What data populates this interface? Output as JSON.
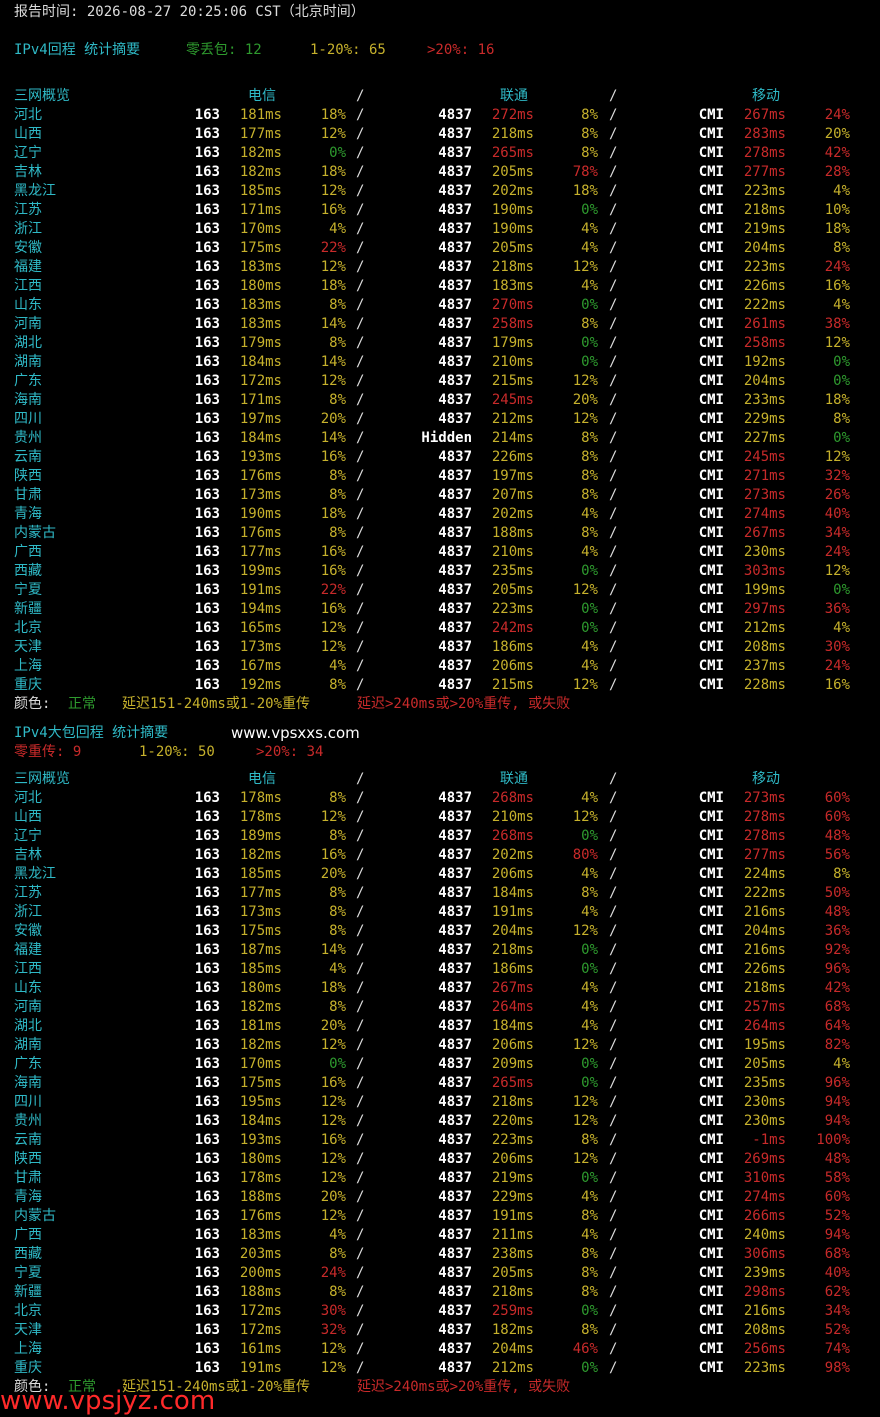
{
  "report_time": "报告时间: 2026-08-27 20:25:06 CST（北京时间）",
  "colors": {
    "normal": "#2e9a2e",
    "warn": "#c6b12c",
    "bad": "#c82a2a",
    "header": "#2fb9c6"
  },
  "sections": [
    {
      "title": "IPv4回程 统计摘要",
      "summary": [
        {
          "text": "零丢包: 12",
          "color": "green"
        },
        {
          "text": "1-20%: 65",
          "color": "yellow"
        },
        {
          "text": ">20%: 16",
          "color": "red"
        }
      ],
      "headers": {
        "region": "三网概览",
        "telecom": "电信",
        "unicom": "联通",
        "mobile": "移动",
        "sep": "/"
      },
      "rows": [
        [
          "河北",
          "163",
          "181ms",
          "y",
          "18%",
          "y",
          "4837",
          "272ms",
          "r",
          "8%",
          "y",
          "CMI",
          "267ms",
          "r",
          "24%",
          "r"
        ],
        [
          "山西",
          "163",
          "177ms",
          "y",
          "12%",
          "y",
          "4837",
          "218ms",
          "y",
          "8%",
          "y",
          "CMI",
          "283ms",
          "r",
          "20%",
          "y"
        ],
        [
          "辽宁",
          "163",
          "182ms",
          "y",
          "0%",
          "g",
          "4837",
          "265ms",
          "r",
          "8%",
          "y",
          "CMI",
          "278ms",
          "r",
          "42%",
          "r"
        ],
        [
          "吉林",
          "163",
          "182ms",
          "y",
          "18%",
          "y",
          "4837",
          "205ms",
          "y",
          "78%",
          "r",
          "CMI",
          "277ms",
          "r",
          "28%",
          "r"
        ],
        [
          "黑龙江",
          "163",
          "185ms",
          "y",
          "12%",
          "y",
          "4837",
          "202ms",
          "y",
          "18%",
          "y",
          "CMI",
          "223ms",
          "y",
          "4%",
          "y"
        ],
        [
          "江苏",
          "163",
          "171ms",
          "y",
          "16%",
          "y",
          "4837",
          "190ms",
          "y",
          "0%",
          "g",
          "CMI",
          "218ms",
          "y",
          "10%",
          "y"
        ],
        [
          "浙江",
          "163",
          "170ms",
          "y",
          "4%",
          "y",
          "4837",
          "190ms",
          "y",
          "4%",
          "y",
          "CMI",
          "219ms",
          "y",
          "18%",
          "y"
        ],
        [
          "安徽",
          "163",
          "175ms",
          "y",
          "22%",
          "r",
          "4837",
          "205ms",
          "y",
          "4%",
          "y",
          "CMI",
          "204ms",
          "y",
          "8%",
          "y"
        ],
        [
          "福建",
          "163",
          "183ms",
          "y",
          "12%",
          "y",
          "4837",
          "218ms",
          "y",
          "12%",
          "y",
          "CMI",
          "223ms",
          "y",
          "24%",
          "r"
        ],
        [
          "江西",
          "163",
          "180ms",
          "y",
          "18%",
          "y",
          "4837",
          "183ms",
          "y",
          "4%",
          "y",
          "CMI",
          "226ms",
          "y",
          "16%",
          "y"
        ],
        [
          "山东",
          "163",
          "183ms",
          "y",
          "8%",
          "y",
          "4837",
          "270ms",
          "r",
          "0%",
          "g",
          "CMI",
          "222ms",
          "y",
          "4%",
          "y"
        ],
        [
          "河南",
          "163",
          "183ms",
          "y",
          "14%",
          "y",
          "4837",
          "258ms",
          "r",
          "8%",
          "y",
          "CMI",
          "261ms",
          "r",
          "38%",
          "r"
        ],
        [
          "湖北",
          "163",
          "179ms",
          "y",
          "8%",
          "y",
          "4837",
          "179ms",
          "y",
          "0%",
          "g",
          "CMI",
          "258ms",
          "r",
          "12%",
          "y"
        ],
        [
          "湖南",
          "163",
          "184ms",
          "y",
          "14%",
          "y",
          "4837",
          "210ms",
          "y",
          "0%",
          "g",
          "CMI",
          "192ms",
          "y",
          "0%",
          "g"
        ],
        [
          "广东",
          "163",
          "172ms",
          "y",
          "12%",
          "y",
          "4837",
          "215ms",
          "y",
          "12%",
          "y",
          "CMI",
          "204ms",
          "y",
          "0%",
          "g"
        ],
        [
          "海南",
          "163",
          "171ms",
          "y",
          "8%",
          "y",
          "4837",
          "245ms",
          "r",
          "20%",
          "y",
          "CMI",
          "233ms",
          "y",
          "18%",
          "y"
        ],
        [
          "四川",
          "163",
          "197ms",
          "y",
          "20%",
          "y",
          "4837",
          "212ms",
          "y",
          "12%",
          "y",
          "CMI",
          "229ms",
          "y",
          "8%",
          "y"
        ],
        [
          "贵州",
          "163",
          "184ms",
          "y",
          "14%",
          "y",
          "Hidden",
          "214ms",
          "y",
          "8%",
          "y",
          "CMI",
          "227ms",
          "y",
          "0%",
          "g"
        ],
        [
          "云南",
          "163",
          "193ms",
          "y",
          "16%",
          "y",
          "4837",
          "226ms",
          "y",
          "8%",
          "y",
          "CMI",
          "245ms",
          "r",
          "12%",
          "y"
        ],
        [
          "陕西",
          "163",
          "176ms",
          "y",
          "8%",
          "y",
          "4837",
          "197ms",
          "y",
          "8%",
          "y",
          "CMI",
          "271ms",
          "r",
          "32%",
          "r"
        ],
        [
          "甘肃",
          "163",
          "173ms",
          "y",
          "8%",
          "y",
          "4837",
          "207ms",
          "y",
          "8%",
          "y",
          "CMI",
          "273ms",
          "r",
          "26%",
          "r"
        ],
        [
          "青海",
          "163",
          "190ms",
          "y",
          "18%",
          "y",
          "4837",
          "202ms",
          "y",
          "4%",
          "y",
          "CMI",
          "274ms",
          "r",
          "40%",
          "r"
        ],
        [
          "内蒙古",
          "163",
          "176ms",
          "y",
          "8%",
          "y",
          "4837",
          "188ms",
          "y",
          "8%",
          "y",
          "CMI",
          "267ms",
          "r",
          "34%",
          "r"
        ],
        [
          "广西",
          "163",
          "177ms",
          "y",
          "16%",
          "y",
          "4837",
          "210ms",
          "y",
          "4%",
          "y",
          "CMI",
          "230ms",
          "y",
          "24%",
          "r"
        ],
        [
          "西藏",
          "163",
          "199ms",
          "y",
          "16%",
          "y",
          "4837",
          "235ms",
          "y",
          "0%",
          "g",
          "CMI",
          "303ms",
          "r",
          "12%",
          "y"
        ],
        [
          "宁夏",
          "163",
          "191ms",
          "y",
          "22%",
          "r",
          "4837",
          "205ms",
          "y",
          "12%",
          "y",
          "CMI",
          "199ms",
          "y",
          "0%",
          "g"
        ],
        [
          "新疆",
          "163",
          "194ms",
          "y",
          "16%",
          "y",
          "4837",
          "223ms",
          "y",
          "0%",
          "g",
          "CMI",
          "297ms",
          "r",
          "36%",
          "r"
        ],
        [
          "北京",
          "163",
          "165ms",
          "y",
          "12%",
          "y",
          "4837",
          "242ms",
          "r",
          "0%",
          "g",
          "CMI",
          "212ms",
          "y",
          "4%",
          "y"
        ],
        [
          "天津",
          "163",
          "173ms",
          "y",
          "12%",
          "y",
          "4837",
          "186ms",
          "y",
          "4%",
          "y",
          "CMI",
          "208ms",
          "y",
          "30%",
          "r"
        ],
        [
          "上海",
          "163",
          "167ms",
          "y",
          "4%",
          "y",
          "4837",
          "206ms",
          "y",
          "4%",
          "y",
          "CMI",
          "237ms",
          "y",
          "24%",
          "r"
        ],
        [
          "重庆",
          "163",
          "192ms",
          "y",
          "8%",
          "y",
          "4837",
          "215ms",
          "y",
          "12%",
          "y",
          "CMI",
          "228ms",
          "y",
          "16%",
          "y"
        ]
      ],
      "legend": {
        "label": "颜色:",
        "normal": "正常",
        "warn": "延迟151-240ms或1-20%重传",
        "bad": "延迟>240ms或>20%重传, 或失败"
      }
    },
    {
      "title": "IPv4大包回程 统计摘要",
      "site": "www.vpsxxs.com",
      "summary": [
        {
          "text": "零重传: 9",
          "color": "red"
        },
        {
          "text": "1-20%: 50",
          "color": "yellow"
        },
        {
          "text": ">20%: 34",
          "color": "red"
        }
      ],
      "headers": {
        "region": "三网概览",
        "telecom": "电信",
        "unicom": "联通",
        "mobile": "移动",
        "sep": "/"
      },
      "rows": [
        [
          "河北",
          "163",
          "178ms",
          "y",
          "8%",
          "y",
          "4837",
          "268ms",
          "r",
          "4%",
          "y",
          "CMI",
          "273ms",
          "r",
          "60%",
          "r"
        ],
        [
          "山西",
          "163",
          "178ms",
          "y",
          "12%",
          "y",
          "4837",
          "210ms",
          "y",
          "12%",
          "y",
          "CMI",
          "278ms",
          "r",
          "60%",
          "r"
        ],
        [
          "辽宁",
          "163",
          "189ms",
          "y",
          "8%",
          "y",
          "4837",
          "268ms",
          "r",
          "0%",
          "g",
          "CMI",
          "278ms",
          "r",
          "48%",
          "r"
        ],
        [
          "吉林",
          "163",
          "182ms",
          "y",
          "16%",
          "y",
          "4837",
          "202ms",
          "y",
          "80%",
          "r",
          "CMI",
          "277ms",
          "r",
          "56%",
          "r"
        ],
        [
          "黑龙江",
          "163",
          "185ms",
          "y",
          "20%",
          "y",
          "4837",
          "206ms",
          "y",
          "4%",
          "y",
          "CMI",
          "224ms",
          "y",
          "8%",
          "y"
        ],
        [
          "江苏",
          "163",
          "177ms",
          "y",
          "8%",
          "y",
          "4837",
          "184ms",
          "y",
          "8%",
          "y",
          "CMI",
          "222ms",
          "y",
          "50%",
          "r"
        ],
        [
          "浙江",
          "163",
          "173ms",
          "y",
          "8%",
          "y",
          "4837",
          "191ms",
          "y",
          "4%",
          "y",
          "CMI",
          "216ms",
          "y",
          "48%",
          "r"
        ],
        [
          "安徽",
          "163",
          "175ms",
          "y",
          "8%",
          "y",
          "4837",
          "204ms",
          "y",
          "12%",
          "y",
          "CMI",
          "204ms",
          "y",
          "36%",
          "r"
        ],
        [
          "福建",
          "163",
          "187ms",
          "y",
          "14%",
          "y",
          "4837",
          "218ms",
          "y",
          "0%",
          "g",
          "CMI",
          "216ms",
          "y",
          "92%",
          "r"
        ],
        [
          "江西",
          "163",
          "185ms",
          "y",
          "4%",
          "y",
          "4837",
          "186ms",
          "y",
          "0%",
          "g",
          "CMI",
          "226ms",
          "y",
          "96%",
          "r"
        ],
        [
          "山东",
          "163",
          "180ms",
          "y",
          "18%",
          "y",
          "4837",
          "267ms",
          "r",
          "4%",
          "y",
          "CMI",
          "218ms",
          "y",
          "42%",
          "r"
        ],
        [
          "河南",
          "163",
          "182ms",
          "y",
          "8%",
          "y",
          "4837",
          "264ms",
          "r",
          "4%",
          "y",
          "CMI",
          "257ms",
          "r",
          "68%",
          "r"
        ],
        [
          "湖北",
          "163",
          "181ms",
          "y",
          "20%",
          "y",
          "4837",
          "184ms",
          "y",
          "4%",
          "y",
          "CMI",
          "264ms",
          "r",
          "64%",
          "r"
        ],
        [
          "湖南",
          "163",
          "182ms",
          "y",
          "12%",
          "y",
          "4837",
          "206ms",
          "y",
          "12%",
          "y",
          "CMI",
          "195ms",
          "y",
          "82%",
          "r"
        ],
        [
          "广东",
          "163",
          "170ms",
          "y",
          "0%",
          "g",
          "4837",
          "209ms",
          "y",
          "0%",
          "g",
          "CMI",
          "205ms",
          "y",
          "4%",
          "y"
        ],
        [
          "海南",
          "163",
          "175ms",
          "y",
          "16%",
          "y",
          "4837",
          "265ms",
          "r",
          "0%",
          "g",
          "CMI",
          "235ms",
          "y",
          "96%",
          "r"
        ],
        [
          "四川",
          "163",
          "195ms",
          "y",
          "12%",
          "y",
          "4837",
          "218ms",
          "y",
          "12%",
          "y",
          "CMI",
          "230ms",
          "y",
          "94%",
          "r"
        ],
        [
          "贵州",
          "163",
          "184ms",
          "y",
          "12%",
          "y",
          "4837",
          "220ms",
          "y",
          "12%",
          "y",
          "CMI",
          "230ms",
          "y",
          "94%",
          "r"
        ],
        [
          "云南",
          "163",
          "193ms",
          "y",
          "16%",
          "y",
          "4837",
          "223ms",
          "y",
          "8%",
          "y",
          "CMI",
          "-1ms",
          "r",
          "100%",
          "r"
        ],
        [
          "陕西",
          "163",
          "180ms",
          "y",
          "12%",
          "y",
          "4837",
          "206ms",
          "y",
          "12%",
          "y",
          "CMI",
          "269ms",
          "r",
          "48%",
          "r"
        ],
        [
          "甘肃",
          "163",
          "178ms",
          "y",
          "12%",
          "y",
          "4837",
          "219ms",
          "y",
          "0%",
          "g",
          "CMI",
          "310ms",
          "r",
          "58%",
          "r"
        ],
        [
          "青海",
          "163",
          "188ms",
          "y",
          "20%",
          "y",
          "4837",
          "229ms",
          "y",
          "4%",
          "y",
          "CMI",
          "274ms",
          "r",
          "60%",
          "r"
        ],
        [
          "内蒙古",
          "163",
          "176ms",
          "y",
          "12%",
          "y",
          "4837",
          "191ms",
          "y",
          "8%",
          "y",
          "CMI",
          "266ms",
          "r",
          "52%",
          "r"
        ],
        [
          "广西",
          "163",
          "183ms",
          "y",
          "4%",
          "y",
          "4837",
          "211ms",
          "y",
          "4%",
          "y",
          "CMI",
          "240ms",
          "y",
          "94%",
          "r"
        ],
        [
          "西藏",
          "163",
          "203ms",
          "y",
          "8%",
          "y",
          "4837",
          "238ms",
          "y",
          "8%",
          "y",
          "CMI",
          "306ms",
          "r",
          "68%",
          "r"
        ],
        [
          "宁夏",
          "163",
          "200ms",
          "y",
          "24%",
          "r",
          "4837",
          "205ms",
          "y",
          "8%",
          "y",
          "CMI",
          "239ms",
          "y",
          "40%",
          "r"
        ],
        [
          "新疆",
          "163",
          "188ms",
          "y",
          "8%",
          "y",
          "4837",
          "218ms",
          "y",
          "8%",
          "y",
          "CMI",
          "298ms",
          "r",
          "62%",
          "r"
        ],
        [
          "北京",
          "163",
          "172ms",
          "y",
          "30%",
          "r",
          "4837",
          "259ms",
          "r",
          "0%",
          "g",
          "CMI",
          "216ms",
          "y",
          "34%",
          "r"
        ],
        [
          "天津",
          "163",
          "172ms",
          "y",
          "32%",
          "r",
          "4837",
          "182ms",
          "y",
          "8%",
          "y",
          "CMI",
          "208ms",
          "y",
          "52%",
          "r"
        ],
        [
          "上海",
          "163",
          "161ms",
          "y",
          "12%",
          "y",
          "4837",
          "204ms",
          "y",
          "46%",
          "r",
          "CMI",
          "256ms",
          "r",
          "74%",
          "r"
        ],
        [
          "重庆",
          "163",
          "191ms",
          "y",
          "12%",
          "y",
          "4837",
          "212ms",
          "y",
          "0%",
          "g",
          "CMI",
          "223ms",
          "y",
          "98%",
          "r"
        ]
      ],
      "legend": {
        "label": "颜色:",
        "normal": "正常",
        "warn": "延迟151-240ms或1-20%重传",
        "bad": "延迟>240ms或>20%重传, 或失败"
      }
    }
  ],
  "watermark": "www.vpsjyz.com"
}
